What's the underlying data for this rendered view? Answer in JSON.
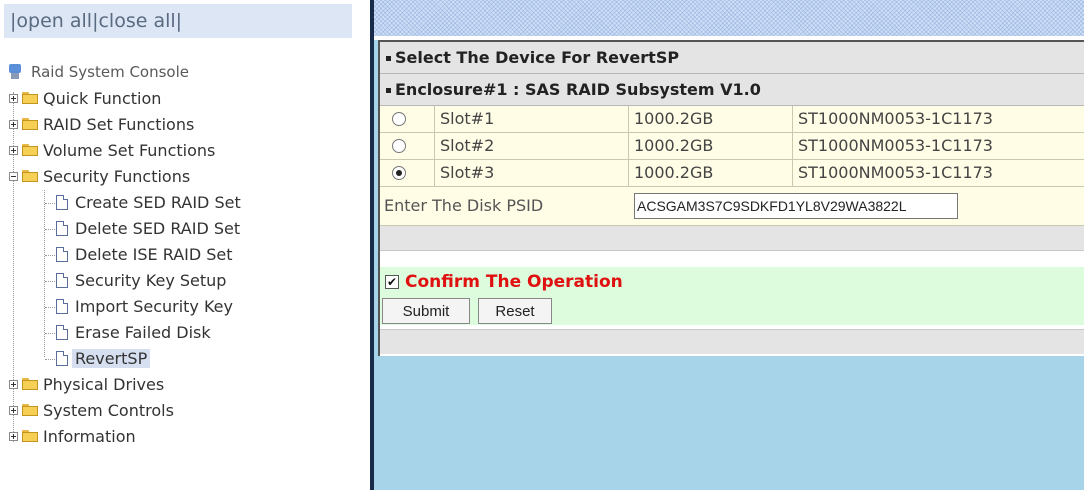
{
  "topbar": {
    "prefix": "|",
    "open_all": "open all",
    "separator": "|",
    "close_all": "close all",
    "suffix": "|"
  },
  "tree": {
    "root": "Raid System Console",
    "items": [
      {
        "label": "Quick Function",
        "type": "folder",
        "expanded": false
      },
      {
        "label": "RAID Set Functions",
        "type": "folder",
        "expanded": false
      },
      {
        "label": "Volume Set Functions",
        "type": "folder",
        "expanded": false
      },
      {
        "label": "Security Functions",
        "type": "folder",
        "expanded": true,
        "children": [
          {
            "label": "Create SED RAID Set"
          },
          {
            "label": "Delete SED RAID Set"
          },
          {
            "label": "Delete ISE RAID Set"
          },
          {
            "label": "Security Key Setup"
          },
          {
            "label": "Import Security Key"
          },
          {
            "label": "Erase Failed Disk"
          },
          {
            "label": "RevertSP",
            "selected": true
          }
        ]
      },
      {
        "label": "Physical Drives",
        "type": "folder",
        "expanded": false
      },
      {
        "label": "System Controls",
        "type": "folder",
        "expanded": false
      },
      {
        "label": "Information",
        "type": "folder",
        "expanded": false
      }
    ]
  },
  "form": {
    "title": "Select The Device For RevertSP",
    "enclosure": "Enclosure#1 : SAS RAID Subsystem V1.0",
    "devices": [
      {
        "slot": "Slot#1",
        "capacity": "1000.2GB",
        "model": "ST1000NM0053-1C1173",
        "selected": false
      },
      {
        "slot": "Slot#2",
        "capacity": "1000.2GB",
        "model": "ST1000NM0053-1C1173",
        "selected": false
      },
      {
        "slot": "Slot#3",
        "capacity": "1000.2GB",
        "model": "ST1000NM0053-1C1173",
        "selected": true
      }
    ],
    "psid_label": "Enter The Disk PSID",
    "psid_value": "ACSGAM3S7C9SDKFD1YL8V29WA3822L",
    "confirm_label": "Confirm The Operation",
    "confirm_checked": true,
    "submit_label": "Submit",
    "reset_label": "Reset"
  },
  "colors": {
    "confirm_text": "#e01010",
    "confirm_bg": "#ddfbdd",
    "row_bg": "#fffde6",
    "right_bg": "#a8d4ea"
  }
}
